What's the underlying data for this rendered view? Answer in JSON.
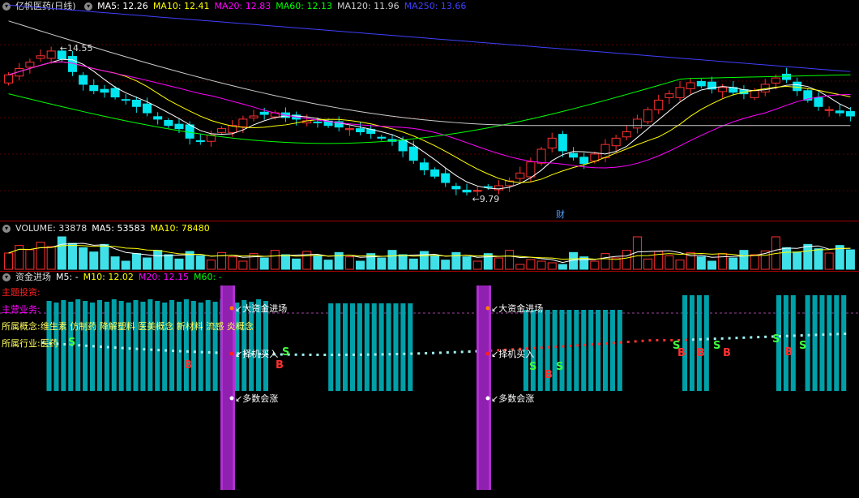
{
  "main_panel": {
    "title": "亿帆医药(日线)",
    "ma_labels": [
      {
        "text": "MA5: 12.26",
        "color": "#ffffff"
      },
      {
        "text": "MA10: 12.41",
        "color": "#ffff00"
      },
      {
        "text": "MA20: 12.83",
        "color": "#ff00ff"
      },
      {
        "text": "MA60: 12.13",
        "color": "#00ff00"
      },
      {
        "text": "MA120: 11.96",
        "color": "#cccccc"
      },
      {
        "text": "MA250: 13.66",
        "color": "#4040ff"
      }
    ],
    "high_label": "14.55",
    "low_label": "9.79",
    "cai_marker": "财"
  },
  "volume_panel": {
    "labels": [
      {
        "text": "VOLUME: 33878",
        "color": "#dddddd"
      },
      {
        "text": "MA5: 53583",
        "color": "#ffffff"
      },
      {
        "text": "MA10: 78480",
        "color": "#ffff00"
      }
    ]
  },
  "fund_panel": {
    "labels": [
      {
        "text": "资金进场",
        "color": "#dddddd"
      },
      {
        "text": "M5: -",
        "color": "#ffffff"
      },
      {
        "text": "M10: 12.02",
        "color": "#ffff00"
      },
      {
        "text": "M20: 12.15",
        "color": "#ff00ff"
      },
      {
        "text": "M60: -",
        "color": "#00ff00"
      }
    ],
    "info_lines": [
      {
        "key": "主题投资:",
        "value": "",
        "color": "#ff2020"
      },
      {
        "key": "主营业务:",
        "value": "",
        "color": "#ff00ff"
      },
      {
        "key": "所属概念:",
        "value": "维生素 仿制药 降解塑料 医美概念 新材料 流感 炎概念",
        "color": "#ffff60"
      },
      {
        "key": "所属行业:",
        "value": "医药",
        "color": "#ffff60"
      }
    ],
    "annotations": {
      "big_fund": "大资金进场",
      "choose_buy": "择机买入",
      "more_rise": "多数会涨",
      "buy": "B",
      "sell": "S"
    }
  },
  "chart_data": {
    "type": "candlestick",
    "y_range": [
      9.2,
      15.6
    ],
    "price_high": 14.55,
    "price_low": 9.79,
    "ma_series": [
      {
        "name": "MA5",
        "last": 12.26,
        "color": "#ffffff"
      },
      {
        "name": "MA10",
        "last": 12.41,
        "color": "#ffff00"
      },
      {
        "name": "MA20",
        "last": 12.83,
        "color": "#ff00ff"
      },
      {
        "name": "MA60",
        "last": 12.13,
        "color": "#00ff00"
      },
      {
        "name": "MA120",
        "last": 11.96,
        "color": "#cccccc"
      },
      {
        "name": "MA250",
        "last": 13.66,
        "color": "#4040ff"
      }
    ],
    "close_path": [
      13.7,
      13.9,
      14.1,
      14.3,
      14.45,
      14.2,
      13.8,
      13.4,
      13.2,
      13.15,
      13.0,
      12.9,
      12.7,
      12.5,
      12.3,
      12.1,
      12.0,
      11.7,
      11.6,
      11.8,
      12.0,
      12.1,
      12.3,
      12.4,
      12.45,
      12.5,
      12.35,
      12.3,
      12.25,
      12.2,
      12.1,
      12.05,
      12.0,
      11.9,
      11.85,
      11.7,
      11.6,
      11.3,
      11.0,
      10.7,
      10.5,
      10.3,
      10.1,
      10.0,
      10.05,
      10.15,
      10.2,
      10.35,
      10.6,
      10.95,
      11.35,
      11.7,
      11.3,
      11.1,
      10.9,
      11.2,
      11.5,
      11.7,
      11.9,
      12.3,
      12.6,
      12.9,
      13.1,
      13.3,
      13.45,
      13.35,
      13.25,
      13.3,
      13.15,
      13.1,
      13.2,
      13.4,
      13.6,
      13.55,
      13.2,
      12.9,
      12.7,
      12.6,
      12.5,
      12.4
    ],
    "volume": {
      "last": 33878,
      "ma5": 53583,
      "ma10": 78480
    },
    "fund": {
      "m10": 12.02,
      "m20": 12.15
    }
  }
}
